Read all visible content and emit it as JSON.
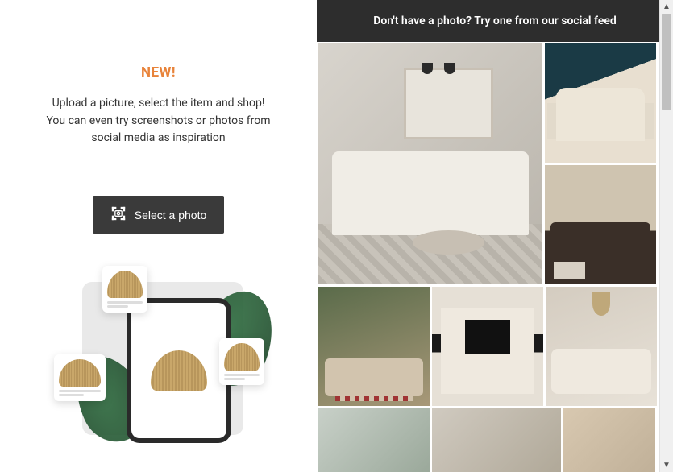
{
  "left": {
    "badge": "NEW!",
    "desc_line1": "Upload a picture, select the item and shop!",
    "desc_line2": "You can even try screenshots or photos from social media as inspiration",
    "select_button": "Select a photo"
  },
  "feed": {
    "header": "Don't have a photo? Try one from our social feed",
    "tiles": [
      {
        "name": "living-room-sectional-white"
      },
      {
        "name": "bedroom-traditional-white"
      },
      {
        "name": "sectional-dark-leather"
      },
      {
        "name": "outdoor-patio-set"
      },
      {
        "name": "entertainment-center-tv"
      },
      {
        "name": "living-room-cream-sectional"
      },
      {
        "name": "living-room-green-curtains"
      },
      {
        "name": "living-room-bright-windows"
      },
      {
        "name": "room-neutral-wall"
      }
    ]
  }
}
